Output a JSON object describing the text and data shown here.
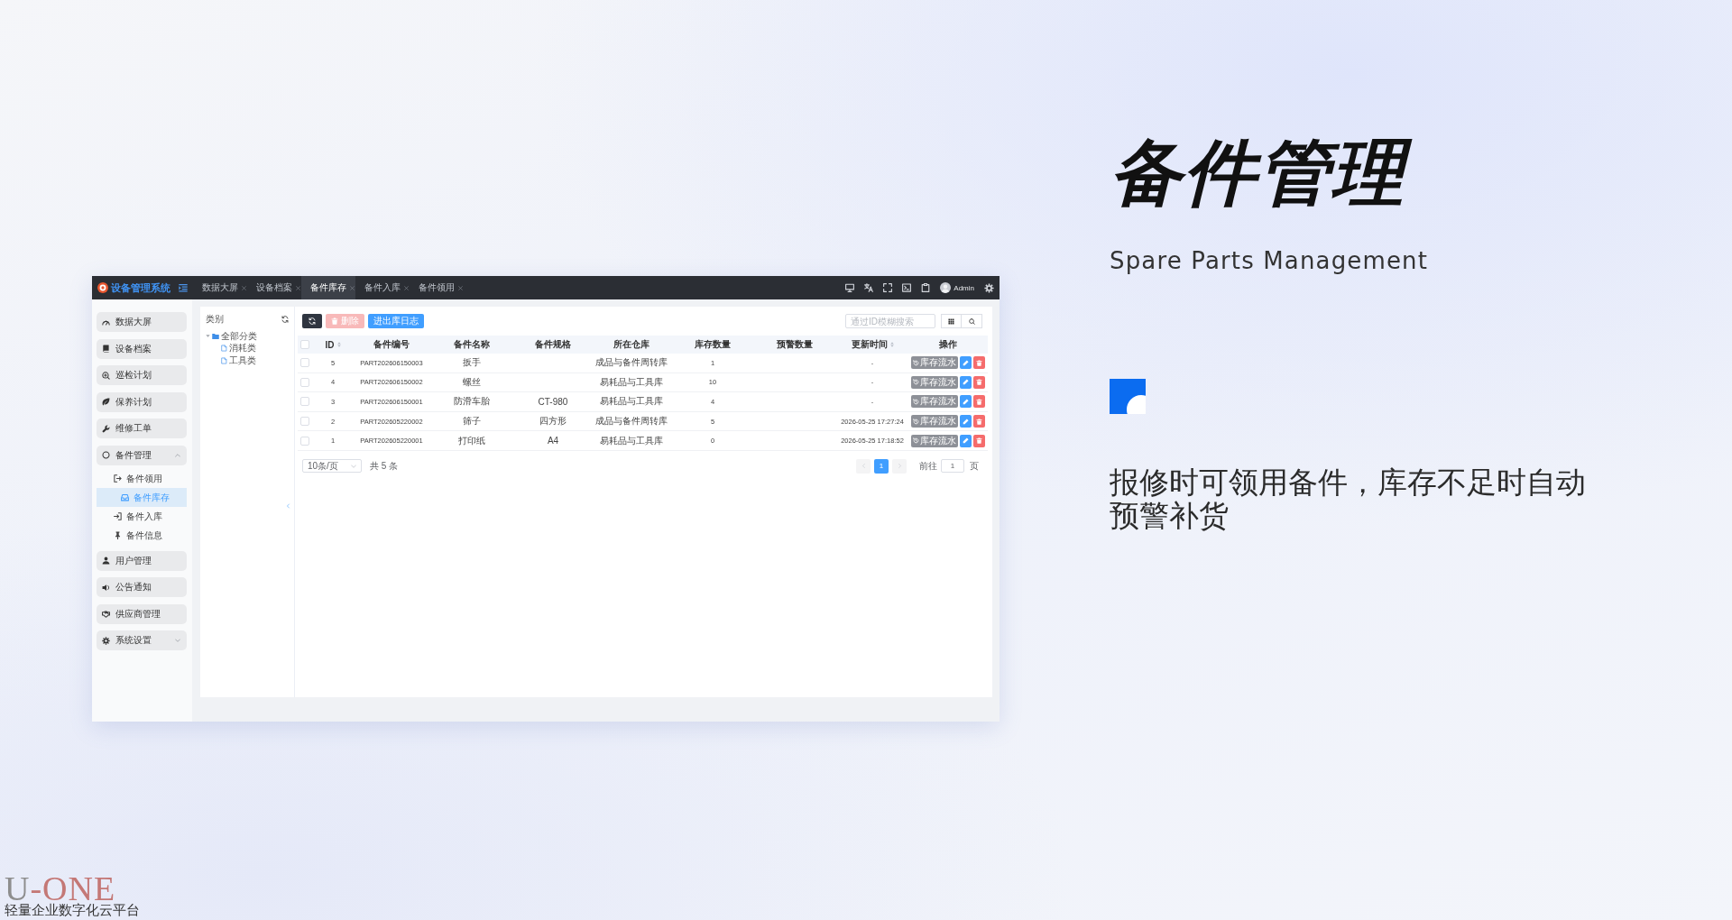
{
  "app": {
    "brand": {
      "title": "设备管理系统"
    },
    "tabs": [
      {
        "label": "数据大屏",
        "selected": false
      },
      {
        "label": "设备档案",
        "selected": false
      },
      {
        "label": "备件库存",
        "selected": true
      },
      {
        "label": "备件入库",
        "selected": false
      },
      {
        "label": "备件领用",
        "selected": false
      }
    ],
    "user": {
      "name": "Admin"
    },
    "sidebar": {
      "items": [
        {
          "label": "数据大屏",
          "selected": false
        },
        {
          "label": "设备档案",
          "selected": false
        },
        {
          "label": "巡检计划",
          "selected": false
        },
        {
          "label": "保养计划",
          "selected": false
        },
        {
          "label": "维修工单",
          "selected": false
        },
        {
          "label": "备件管理",
          "selected": false,
          "expanded": true,
          "children": [
            {
              "label": "备件领用",
              "selected": false
            },
            {
              "label": "备件库存",
              "selected": true
            },
            {
              "label": "备件入库",
              "selected": false
            },
            {
              "label": "备件信息",
              "selected": false
            }
          ]
        },
        {
          "label": "用户管理",
          "selected": false
        },
        {
          "label": "公告通知",
          "selected": false
        },
        {
          "label": "供应商管理",
          "selected": false
        },
        {
          "label": "系统设置",
          "selected": false,
          "expanded": false
        }
      ]
    },
    "category_panel": {
      "title": "类别",
      "tree": [
        {
          "label": "全部分类",
          "expanded": true,
          "children": [
            {
              "label": "消耗类"
            },
            {
              "label": "工具类"
            }
          ]
        }
      ]
    },
    "toolbar": {
      "buttons": [
        {
          "label": "删除",
          "kind": "danger",
          "disabled": true
        },
        {
          "label": "进出库日志",
          "kind": "primary",
          "disabled": false
        }
      ],
      "search": {
        "placeholder": "通过ID模糊搜索"
      }
    },
    "table": {
      "all_checked": false,
      "columns": [
        {
          "label": "ID",
          "sortable": true
        },
        {
          "label": "备件编号",
          "sortable": false
        },
        {
          "label": "备件名称",
          "sortable": false
        },
        {
          "label": "备件规格",
          "sortable": false
        },
        {
          "label": "所在仓库",
          "sortable": false
        },
        {
          "label": "库存数量",
          "sortable": false
        },
        {
          "label": "预警数量",
          "sortable": false
        },
        {
          "label": "更新时间",
          "sortable": true
        },
        {
          "label": "操作",
          "sortable": false
        }
      ],
      "rows": [
        {
          "checked": false,
          "id": "5",
          "part_no": "PART202606150003",
          "name": "扳手",
          "warehouse": "成品与备件周转库",
          "stock": "1",
          "updated_at": "-",
          "action": "库存流水"
        },
        {
          "checked": false,
          "id": "4",
          "part_no": "PART202606150002",
          "name": "螺丝",
          "warehouse": "易耗品与工具库",
          "stock": "10",
          "updated_at": "-",
          "action": "库存流水"
        },
        {
          "checked": false,
          "id": "3",
          "part_no": "PART202606150001",
          "name": "防滑车胎",
          "spec": "CT-980",
          "warehouse": "易耗品与工具库",
          "stock": "4",
          "updated_at": "-",
          "action": "库存流水"
        },
        {
          "checked": false,
          "id": "2",
          "part_no": "PART202605220002",
          "name": "筛子",
          "spec": "四方形",
          "warehouse": "成品与备件周转库",
          "stock": "5",
          "updated_at": "2026-05-25 17:27:24",
          "action": "库存流水"
        },
        {
          "checked": false,
          "id": "1",
          "part_no": "PART202605220001",
          "name": "打印纸",
          "spec": "A4",
          "warehouse": "易耗品与工具库",
          "stock": "0",
          "updated_at": "2026-05-25 17:18:52",
          "action": "库存流水"
        }
      ]
    },
    "pagination": {
      "page_size": "10条/页",
      "total": "共 5 条",
      "pages": [
        {
          "label": "1",
          "selected": true
        }
      ],
      "goto_label": "前往",
      "goto_value": "1",
      "page_unit": "页"
    }
  },
  "slide": {
    "title": "备件管理",
    "subtitle": "Spare Parts Management",
    "description": "报修时可领用备件，库存不足时自动预警补货"
  },
  "footer": {
    "logo": [
      {
        "text": "U",
        "color": "#8e8e8e"
      },
      {
        "text": "-ONE",
        "color": "#c47876"
      }
    ],
    "tagline": "轻量企业数字化云平台"
  }
}
